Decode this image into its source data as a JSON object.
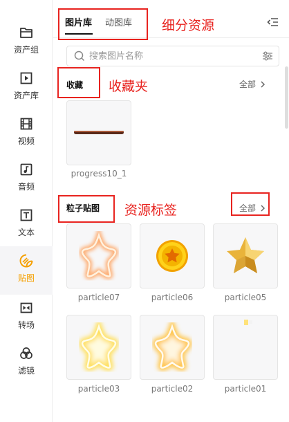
{
  "sidebar": {
    "items": [
      {
        "label": "资产组",
        "icon": "folder-icon"
      },
      {
        "label": "资产库",
        "icon": "play-box-icon"
      },
      {
        "label": "视频",
        "icon": "film-icon"
      },
      {
        "label": "音频",
        "icon": "music-note-icon"
      },
      {
        "label": "文本",
        "icon": "text-box-icon"
      },
      {
        "label": "贴图",
        "icon": "sticker-icon",
        "active": true
      },
      {
        "label": "转场",
        "icon": "transition-icon"
      },
      {
        "label": "滤镜",
        "icon": "filter-circles-icon"
      }
    ],
    "active_color": "#f5a000"
  },
  "tabs": {
    "items": [
      "图片库",
      "动图库"
    ],
    "active": "图片库"
  },
  "search": {
    "placeholder": "搜索图片名称"
  },
  "favorites": {
    "title": "收藏",
    "see_all": "全部",
    "items": [
      {
        "name": "progress10_1"
      }
    ]
  },
  "particles": {
    "title": "粒子贴图",
    "see_all": "全部",
    "items": [
      {
        "name": "particle07"
      },
      {
        "name": "particle06"
      },
      {
        "name": "particle05"
      },
      {
        "name": "particle03"
      },
      {
        "name": "particle02"
      },
      {
        "name": "particle01"
      }
    ]
  },
  "annotations": {
    "subdivide": "细分资源",
    "favorites": "收藏夹",
    "tag": "资源标签",
    "color": "#e8231f"
  }
}
